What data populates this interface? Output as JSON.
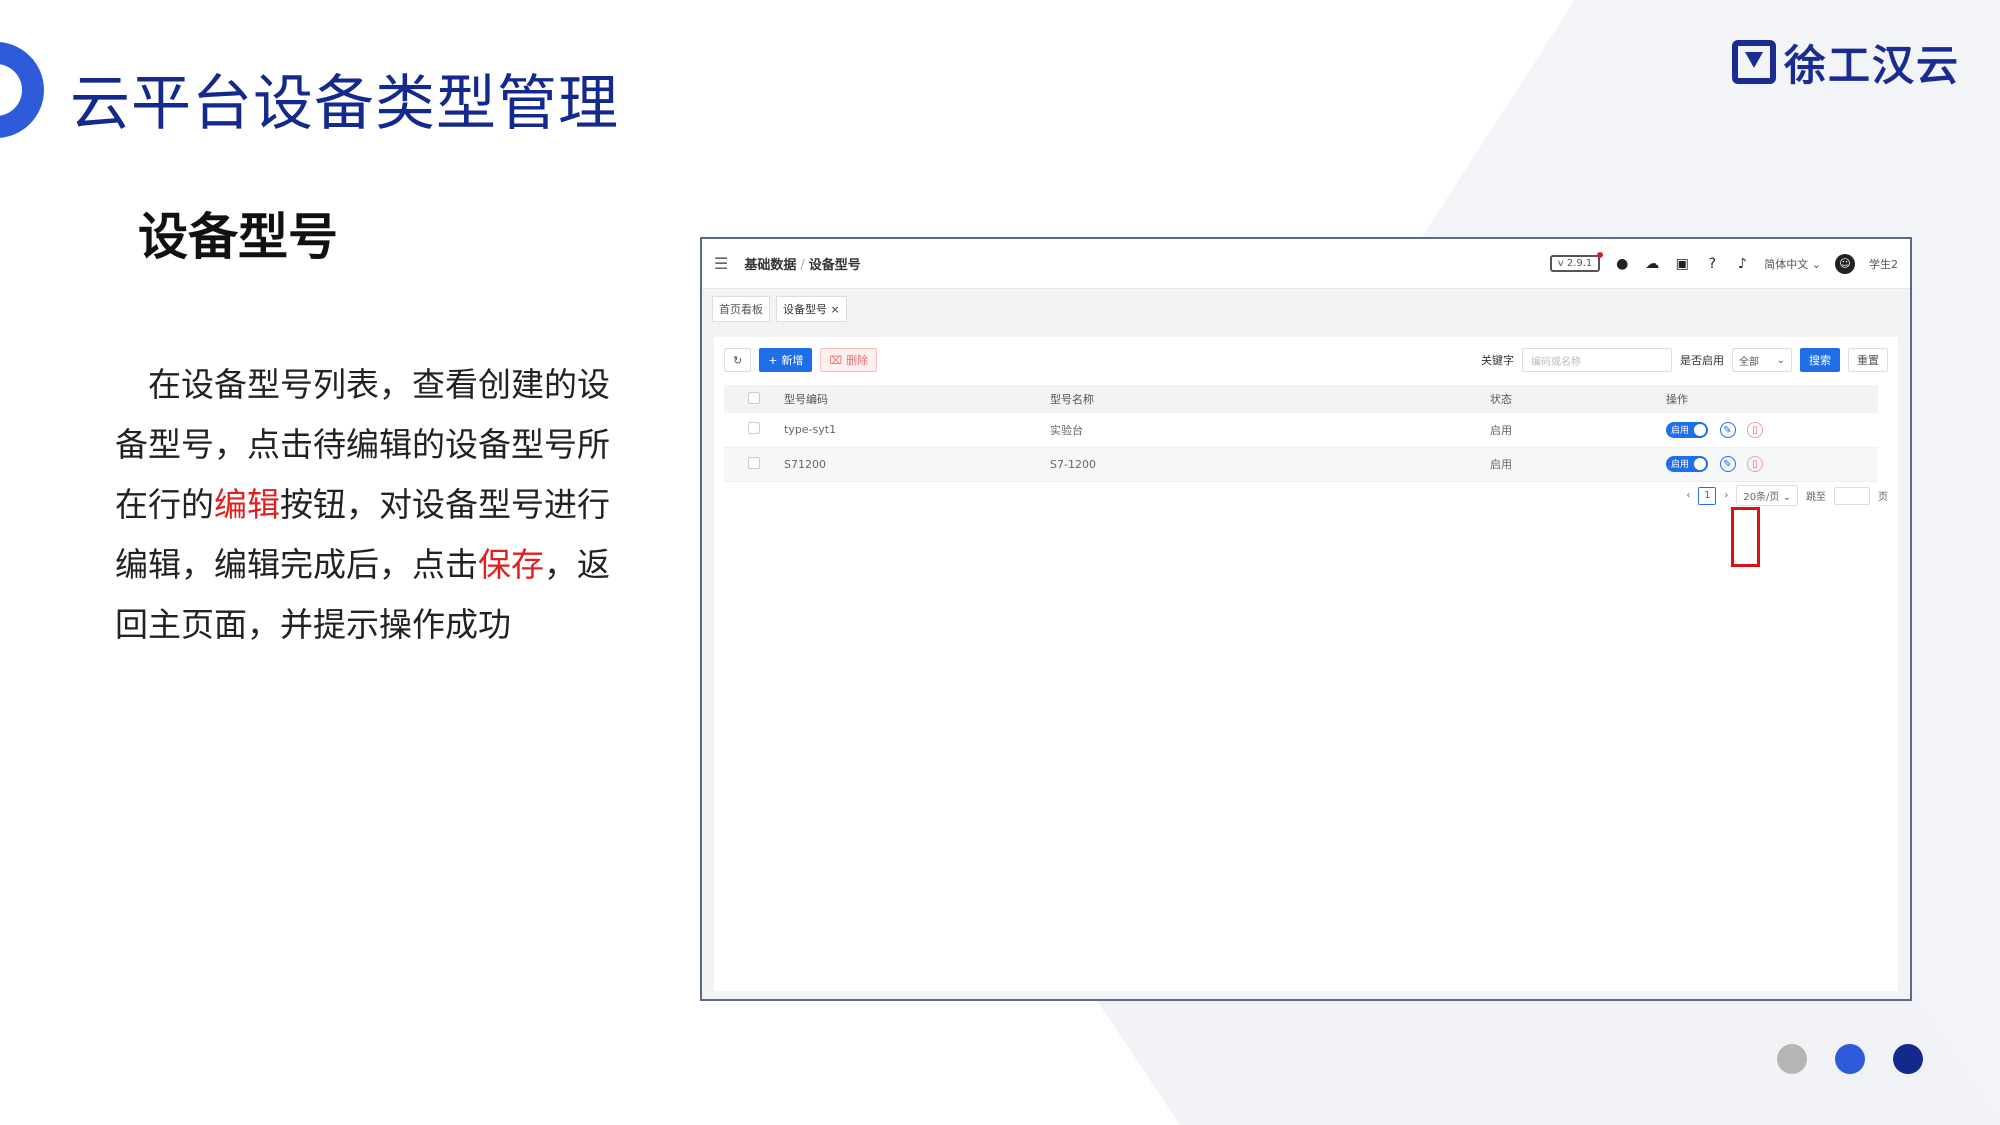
{
  "slide": {
    "title": "云平台设备类型管理",
    "brand": "徐工汉云",
    "section_title": "设备型号",
    "description_parts": [
      "在设备型号列表，查看创建的设备型号，点击待编辑的设备型号所在行的",
      "编辑",
      "按钮，对设备型号进行编辑，编辑完成后，点击",
      "保存",
      "，返回主页面，并提示操作成功"
    ]
  },
  "app": {
    "breadcrumb": [
      "基础数据",
      "设备型号"
    ],
    "version": "v 2.9.1",
    "language": "简体中文",
    "user": "学生2",
    "tabs": [
      "首页看板",
      "设备型号"
    ],
    "toolbar": {
      "add_label": "新增",
      "delete_label": "删除",
      "keyword_label": "关键字",
      "keyword_placeholder": "编码或名称",
      "enabled_label": "是否启用",
      "enabled_value": "全部",
      "search_label": "搜索",
      "reset_label": "重置"
    },
    "table": {
      "columns": [
        "型号编码",
        "型号名称",
        "状态",
        "操作"
      ],
      "rows": [
        {
          "code": "type-syt1",
          "name": "实验台",
          "status": "启用",
          "toggle": "启用"
        },
        {
          "code": "S71200",
          "name": "S7-1200",
          "status": "启用",
          "toggle": "启用"
        }
      ]
    },
    "pager": {
      "page": "1",
      "page_size": "20条/页",
      "jump_label": "跳至",
      "page_unit": "页"
    }
  },
  "colors": {
    "title": "#13298c",
    "accent": "#2d5bd9",
    "highlight": "#e02020",
    "primary_button": "#1e6fe8",
    "dot_gray": "#b5b5b5",
    "dot_blue": "#2d5bd9",
    "dot_navy": "#13298c"
  }
}
